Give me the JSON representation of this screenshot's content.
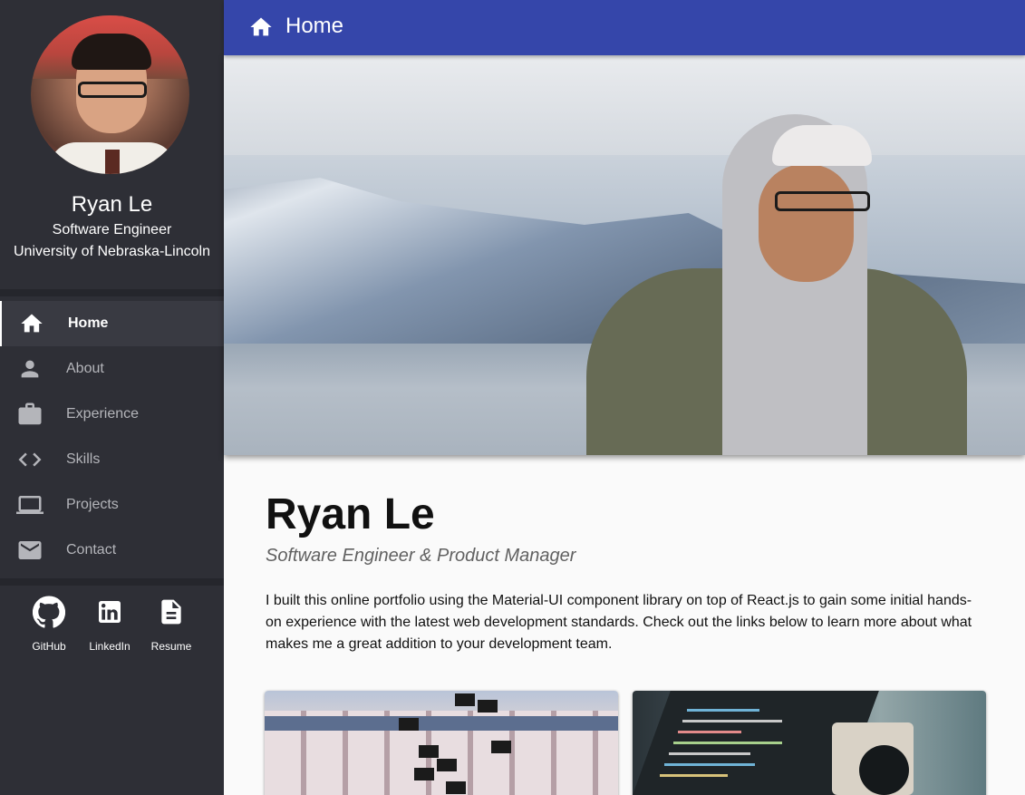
{
  "sidebar": {
    "profile": {
      "name": "Ryan Le",
      "role": "Software Engineer",
      "school": "University of Nebraska-Lincoln"
    },
    "nav": [
      {
        "label": "Home",
        "icon": "home-icon",
        "active": true
      },
      {
        "label": "About",
        "icon": "person-icon",
        "active": false
      },
      {
        "label": "Experience",
        "icon": "briefcase-icon",
        "active": false
      },
      {
        "label": "Skills",
        "icon": "code-icon",
        "active": false
      },
      {
        "label": "Projects",
        "icon": "laptop-icon",
        "active": false
      },
      {
        "label": "Contact",
        "icon": "mail-icon",
        "active": false
      }
    ],
    "social": [
      {
        "label": "GitHub",
        "icon": "github-icon"
      },
      {
        "label": "LinkedIn",
        "icon": "linkedin-icon"
      },
      {
        "label": "Resume",
        "icon": "document-icon"
      }
    ]
  },
  "appbar": {
    "title": "Home",
    "icon": "home-icon"
  },
  "main": {
    "title": "Ryan Le",
    "subtitle": "Software Engineer & Product Manager",
    "intro": "I built this online portfolio using the Material-UI component library on top of React.js to gain some initial hands-on experience with the latest web development standards. Check out the links below to learn more about what makes me a great addition to your development team."
  },
  "colors": {
    "appbar": "#3546aa",
    "sidebar": "#2e2f36",
    "sidebar_active": "#393a42",
    "nav_inactive_text": "#b4b5ba"
  }
}
